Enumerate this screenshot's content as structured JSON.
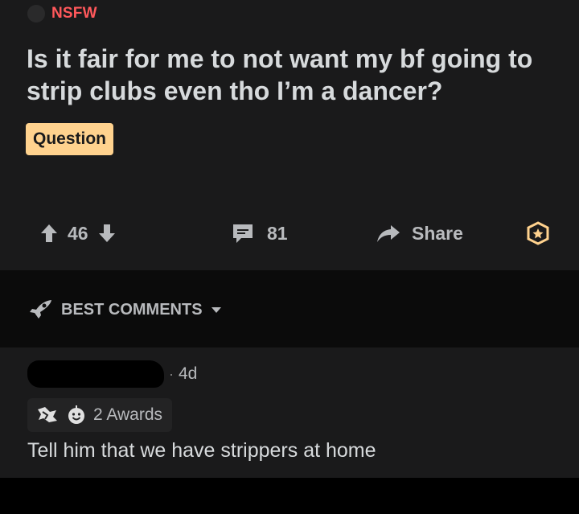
{
  "post": {
    "nsfw_label": "NSFW",
    "title": "Is it fair for me to not want my bf going to strip clubs even tho I’m a dancer?",
    "flair": "Question",
    "votes": "46",
    "comments": "81",
    "share_label": "Share"
  },
  "sort": {
    "label": "BEST COMMENTS"
  },
  "comment": {
    "separator": "·",
    "age": "4d",
    "awards": "2 Awards",
    "body": "Tell him that we have strippers at home"
  },
  "icons": {
    "upvote": "arrow-up-icon",
    "downvote": "arrow-down-icon",
    "comments": "comment-bubble-icon",
    "share": "share-arrow-icon",
    "save": "award-star-icon",
    "sort": "rocket-icon",
    "sort_caret": "caret-down-icon"
  },
  "colors": {
    "nsfw": "#ff585b",
    "flair_bg": "#ffd28e",
    "background": "#1a1a1b",
    "text": "#d7dadc",
    "muted": "#b8babd"
  }
}
